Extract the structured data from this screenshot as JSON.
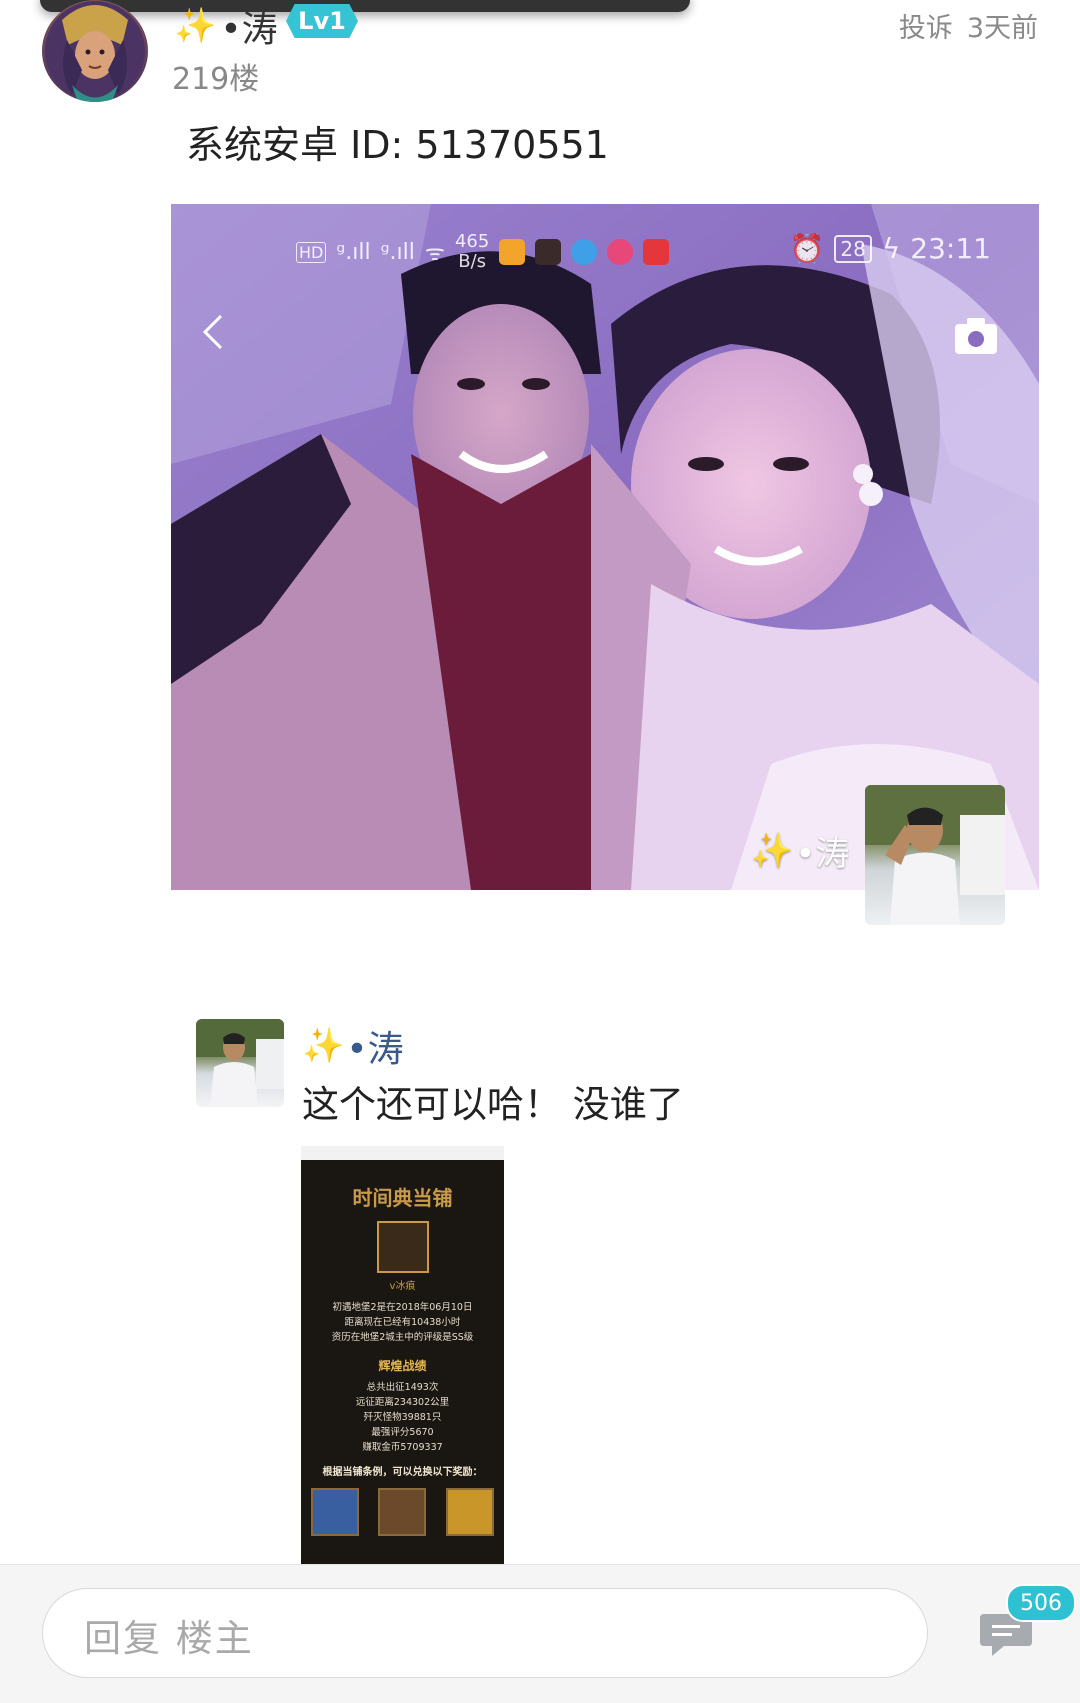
{
  "post": {
    "username": "•涛",
    "level": "Lv1",
    "floor": "219楼",
    "report_label": "投诉",
    "time": "3天前",
    "content": "系统安卓 ID: 51370551"
  },
  "main_image": {
    "status_bar": {
      "speed_value": "465",
      "speed_unit": "B/s",
      "battery": "28",
      "time": "23:11"
    },
    "watermark_name": "•涛"
  },
  "reply": {
    "username": "•涛",
    "text": "这个还可以哈！ 没谁了",
    "thumbnail": {
      "title": "时间典当铺",
      "user": "v冰痕",
      "line1": "初遇地堡2是在2018年06月10日",
      "line2": "距离现在已经有10438小时",
      "line3": "资历在地堡2城主中的评级是SS级",
      "section": "辉煌战绩",
      "stat1": "总共出征1493次",
      "stat2": "远征距离234302公里",
      "stat3": "歼灭怪物39881只",
      "stat4": "最强评分5670",
      "stat5": "赚取金币5709337",
      "footer": "根据当铺条例，可以兑换以下奖励："
    }
  },
  "bottom_bar": {
    "reply_placeholder": "回复 楼主",
    "comment_count": "506"
  },
  "colors": {
    "badge": "#36c3d3",
    "comment_badge": "#2ec1d2",
    "reply_name": "#3a5a8c",
    "photo_tint": "#8b6bc4"
  }
}
